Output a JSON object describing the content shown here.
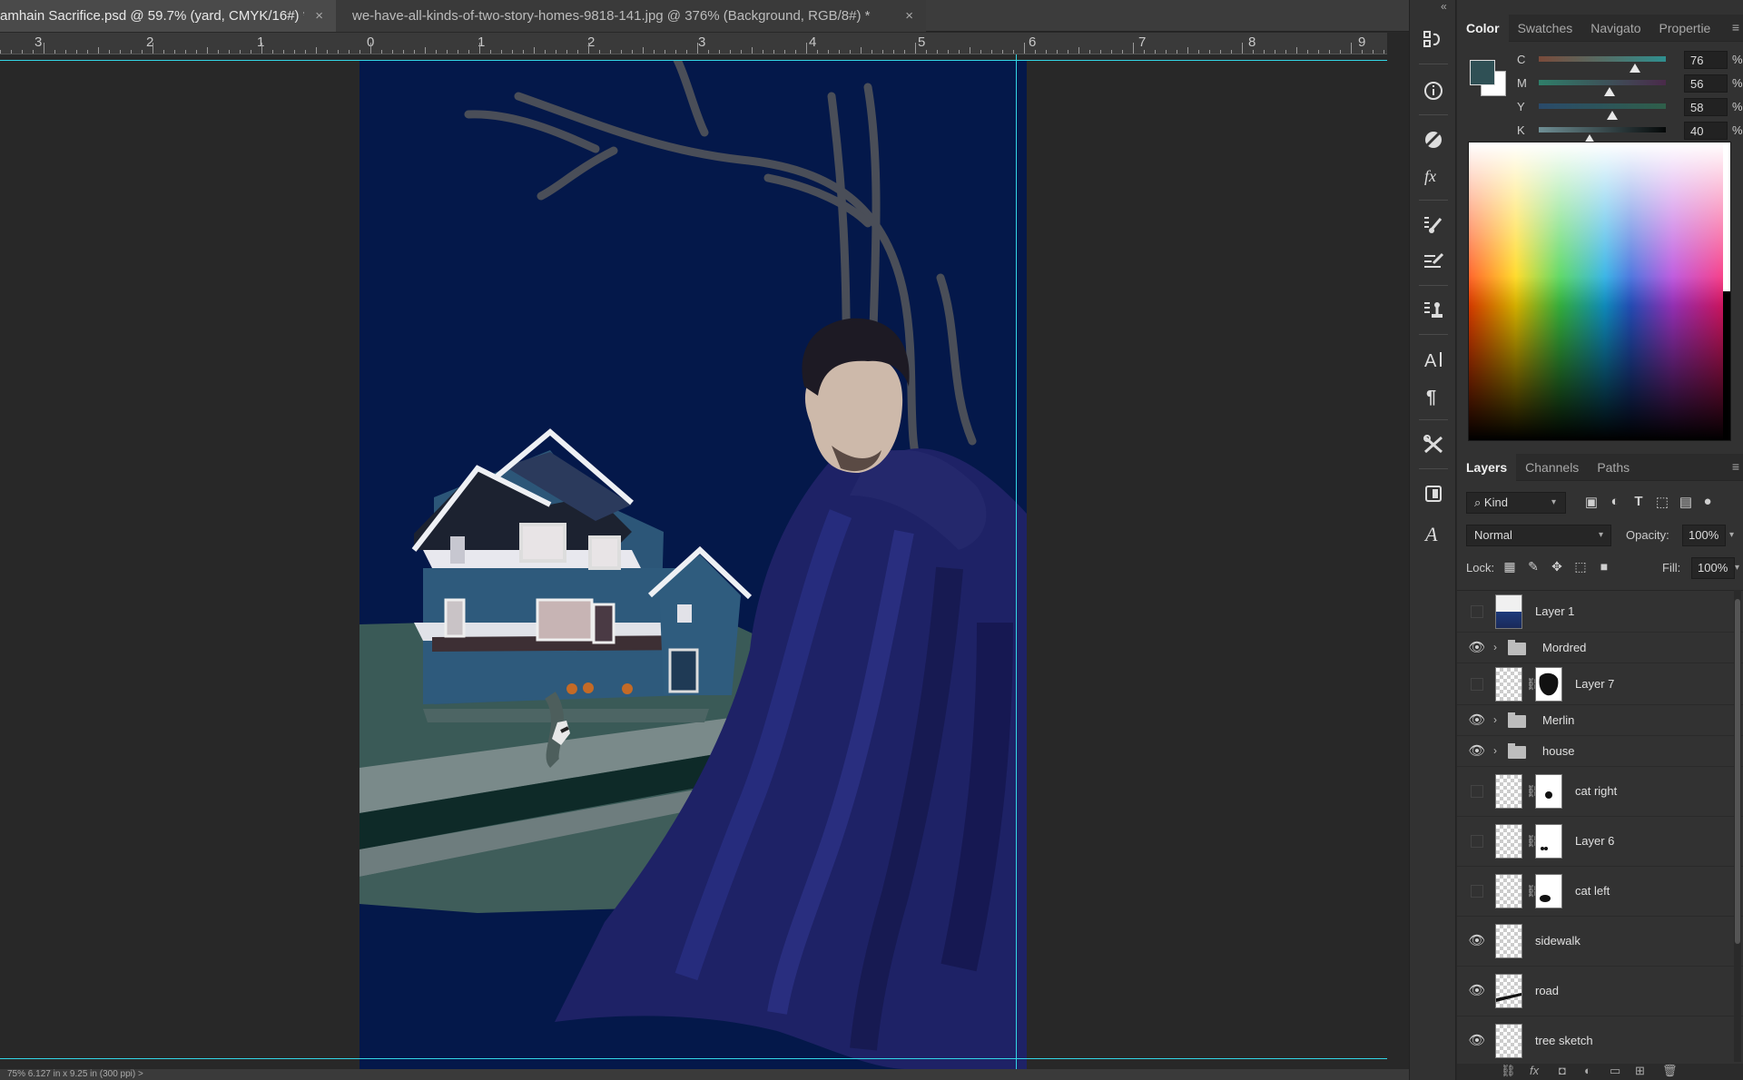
{
  "tabs": [
    {
      "title": "amhain Sacrifice.psd @ 59.7% (yard, CMYK/16#) *",
      "close": "×"
    },
    {
      "title": "we-have-all-kinds-of-two-story-homes-9818-141.jpg @ 376% (Background, RGB/8#) *",
      "close": "×"
    }
  ],
  "ruler": {
    "labels": [
      "3",
      "2",
      "1",
      "0",
      "1",
      "2",
      "3",
      "4",
      "5",
      "6",
      "7",
      "8",
      "9"
    ]
  },
  "status": {
    "text": "75%     6.127 in x 9.25 in (300 ppi)    >"
  },
  "toolstrip": {
    "collapse": "«"
  },
  "color_panel": {
    "tabs": [
      "Color",
      "Swatches",
      "Navigato",
      "Propertie"
    ],
    "menu": "≡",
    "foreground": "#2f5055",
    "background": "#ffffff",
    "channels": [
      {
        "label": "C",
        "value": "76",
        "pct": "%",
        "level": 0.76
      },
      {
        "label": "M",
        "value": "56",
        "pct": "%",
        "level": 0.56
      },
      {
        "label": "Y",
        "value": "58",
        "pct": "%",
        "level": 0.58
      },
      {
        "label": "K",
        "value": "40",
        "pct": "%",
        "level": 0.4
      }
    ]
  },
  "layers_panel": {
    "tabs": [
      "Layers",
      "Channels",
      "Paths"
    ],
    "menu": "≡",
    "kind": "Kind",
    "blend_mode": "Normal",
    "opacity_label": "Opacity:",
    "opacity": "100%",
    "lock_label": "Lock:",
    "fill_label": "Fill:",
    "fill": "100%",
    "layers": [
      {
        "name": "Layer 1",
        "visible": false,
        "type": "layer"
      },
      {
        "name": "Mordred",
        "visible": true,
        "type": "group"
      },
      {
        "name": "Layer 7",
        "visible": false,
        "type": "masked"
      },
      {
        "name": "Merlin",
        "visible": true,
        "type": "group"
      },
      {
        "name": "house",
        "visible": true,
        "type": "group"
      },
      {
        "name": "cat right",
        "visible": false,
        "type": "masked"
      },
      {
        "name": "Layer 6",
        "visible": false,
        "type": "masked"
      },
      {
        "name": "cat left",
        "visible": false,
        "type": "masked"
      },
      {
        "name": "sidewalk",
        "visible": true,
        "type": "layer"
      },
      {
        "name": "road",
        "visible": true,
        "type": "layer"
      },
      {
        "name": "tree sketch",
        "visible": true,
        "type": "layer"
      }
    ]
  }
}
